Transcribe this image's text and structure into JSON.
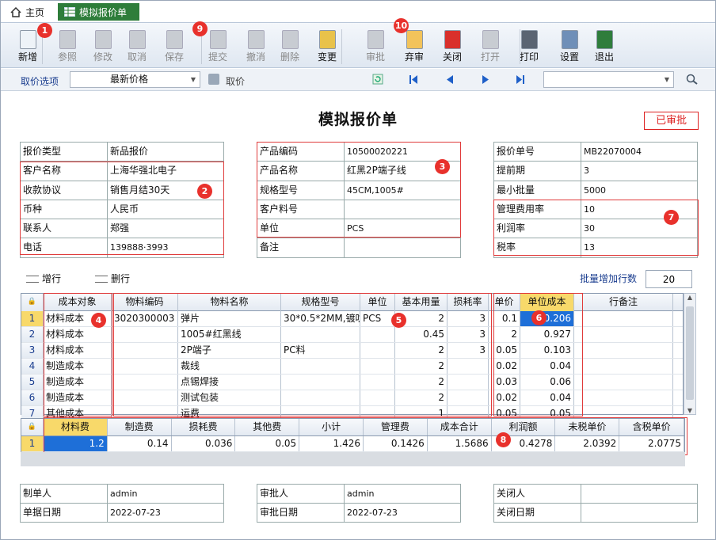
{
  "tabs": {
    "home": "主页",
    "active": "模拟报价单"
  },
  "toolbar": [
    {
      "label": "新增",
      "enabled": true
    },
    {
      "label": "参照",
      "enabled": false
    },
    {
      "label": "修改",
      "enabled": false
    },
    {
      "label": "取消",
      "enabled": false
    },
    {
      "label": "保存",
      "enabled": false
    },
    {
      "label": "提交",
      "enabled": false
    },
    {
      "label": "撤消",
      "enabled": false
    },
    {
      "label": "删除",
      "enabled": false
    },
    {
      "label": "变更",
      "enabled": true
    },
    {
      "label": "审批",
      "enabled": false
    },
    {
      "label": "弃审",
      "enabled": true
    },
    {
      "label": "关闭",
      "enabled": true
    },
    {
      "label": "打开",
      "enabled": false
    },
    {
      "label": "打印",
      "enabled": true
    },
    {
      "label": "设置",
      "enabled": true
    },
    {
      "label": "退出",
      "enabled": true
    }
  ],
  "subbar": {
    "price_option_label": "取价选项",
    "price_option_value": "最新价格",
    "fetch_label": "取价"
  },
  "title": "模拟报价单",
  "status": "已审批",
  "left_form": [
    {
      "k": "报价类型",
      "v": "新品报价"
    },
    {
      "k": "客户名称",
      "v": "上海华强北电子"
    },
    {
      "k": "收款协议",
      "v": "销售月结30天"
    },
    {
      "k": "币种",
      "v": "人民币"
    },
    {
      "k": "联系人",
      "v": "郑强"
    },
    {
      "k": "电话",
      "v": "139888·3993"
    }
  ],
  "mid_form": [
    {
      "k": "产品编码",
      "v": "10500020221"
    },
    {
      "k": "产品名称",
      "v": "红黑2P端子线"
    },
    {
      "k": "规格型号",
      "v": "45CM,1005#"
    },
    {
      "k": "客户料号",
      "v": ""
    },
    {
      "k": "单位",
      "v": "PCS"
    },
    {
      "k": "备注",
      "v": ""
    }
  ],
  "right_form": [
    {
      "k": "报价单号",
      "v": "MB22070004"
    },
    {
      "k": "提前期",
      "v": "3"
    },
    {
      "k": "最小批量",
      "v": "5000"
    },
    {
      "k": "管理费用率",
      "v": "10"
    },
    {
      "k": "利润率",
      "v": "30"
    },
    {
      "k": "税率",
      "v": "13"
    }
  ],
  "grid_tools": {
    "add_row": "增行",
    "del_row": "删行",
    "batch_label": "批量增加行数",
    "batch_value": "20"
  },
  "grid_headers": [
    "成本对象",
    "物料编码",
    "物料名称",
    "规格型号",
    "单位",
    "基本用量",
    "损耗率",
    "单价",
    "单位成本",
    "行备注"
  ],
  "grid_rows": [
    [
      "1",
      "材料成本",
      "3020300003",
      "弹片",
      "30*0.5*2MM,镀叻",
      "PCS",
      "2",
      "3",
      "0.1",
      "0.206",
      ""
    ],
    [
      "2",
      "材料成本",
      "",
      "1005#红黑线",
      "",
      "",
      "0.45",
      "3",
      "2",
      "0.927",
      ""
    ],
    [
      "3",
      "材料成本",
      "",
      "2P端子",
      "PC料",
      "",
      "2",
      "3",
      "0.05",
      "0.103",
      ""
    ],
    [
      "4",
      "制造成本",
      "",
      "裁线",
      "",
      "",
      "2",
      "",
      "0.02",
      "0.04",
      ""
    ],
    [
      "5",
      "制造成本",
      "",
      "点锡焊接",
      "",
      "",
      "2",
      "",
      "0.03",
      "0.06",
      ""
    ],
    [
      "6",
      "制造成本",
      "",
      "测试包装",
      "",
      "",
      "2",
      "",
      "0.02",
      "0.04",
      ""
    ],
    [
      "7",
      "其他成本",
      "",
      "运费",
      "",
      "",
      "1",
      "",
      "0.05",
      "0.05",
      ""
    ]
  ],
  "sum_headers": [
    "材料费",
    "制造费",
    "损耗费",
    "其他费",
    "小计",
    "管理费",
    "成本合计",
    "利润额",
    "未税单价",
    "含税单价"
  ],
  "sum_row": [
    "1",
    "1.2",
    "0.14",
    "0.036",
    "0.05",
    "1.426",
    "0.1426",
    "1.5686",
    "0.4278",
    "2.0392",
    "2.0775"
  ],
  "bottom_left": [
    {
      "k": "制单人",
      "v": "admin"
    },
    {
      "k": "单据日期",
      "v": "2022-07-23"
    }
  ],
  "bottom_mid": [
    {
      "k": "审批人",
      "v": "admin"
    },
    {
      "k": "审批日期",
      "v": "2022-07-23"
    }
  ],
  "bottom_right": [
    {
      "k": "关闭人",
      "v": ""
    },
    {
      "k": "关闭日期",
      "v": ""
    }
  ],
  "markers": [
    "1",
    "2",
    "3",
    "4",
    "5",
    "6",
    "7",
    "8",
    "9",
    "10"
  ],
  "colors": {
    "accent_green": "#2e7d3a",
    "marker_red": "#e8312c",
    "selected_blue": "#1e6fd8",
    "header_yellow": "#f8d96a"
  }
}
